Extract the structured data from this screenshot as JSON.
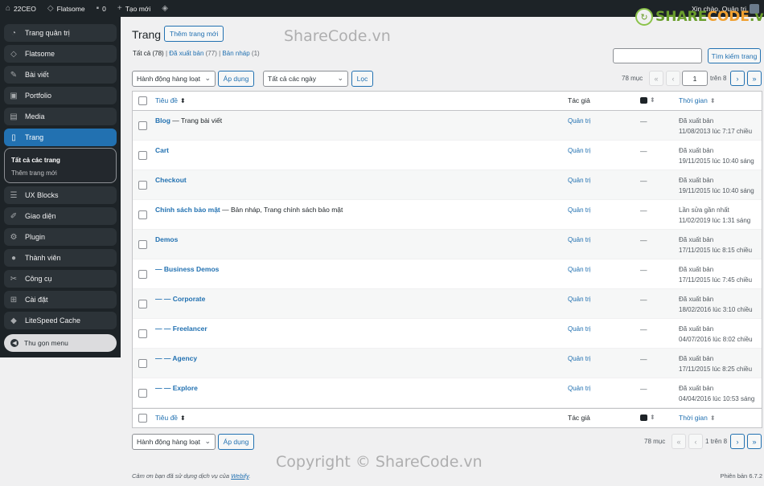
{
  "adminbar": {
    "site_name": "22CEO",
    "theme_name": "Flatsome",
    "comments_count": "0",
    "new_label": "Tạo mới",
    "greeting": "Xin chào, Quản trị"
  },
  "sidebar": {
    "items": [
      {
        "label": "Trang quản trị",
        "icon": "dashboard-icon"
      },
      {
        "label": "Flatsome",
        "icon": "flatsome-icon"
      },
      {
        "label": "Bài viết",
        "icon": "pin-icon"
      },
      {
        "label": "Portfolio",
        "icon": "portfolio-icon"
      },
      {
        "label": "Media",
        "icon": "media-icon"
      },
      {
        "label": "Trang",
        "icon": "page-icon"
      },
      {
        "label": "UX Blocks",
        "icon": "blocks-icon"
      },
      {
        "label": "Giao diện",
        "icon": "brush-icon"
      },
      {
        "label": "Plugin",
        "icon": "plugin-icon"
      },
      {
        "label": "Thành viên",
        "icon": "user-icon"
      },
      {
        "label": "Công cụ",
        "icon": "wrench-icon"
      },
      {
        "label": "Cài đặt",
        "icon": "settings-icon"
      },
      {
        "label": "LiteSpeed Cache",
        "icon": "litespeed-icon"
      }
    ],
    "submenu": [
      "Tất cả các trang",
      "Thêm trang mới"
    ],
    "collapse_label": "Thu gọn menu"
  },
  "page": {
    "title": "Trang",
    "add_new": "Thêm trang mới",
    "filters": {
      "all": "Tất cả",
      "all_count": "(78)",
      "published": "Đã xuất bản",
      "published_count": "(77)",
      "draft": "Bản nháp",
      "draft_count": "(1)"
    },
    "search_button": "Tìm kiếm trang",
    "bulk_action": "Hành động hàng loạt",
    "apply": "Áp dụng",
    "date_filter": "Tất cả các ngày",
    "filter_button": "Lọc",
    "items_count": "78 mục",
    "current_page": "1",
    "of_pages": "trên 8",
    "bottom_pages": "1 trên 8",
    "pager": {
      "first": "«",
      "prev": "‹",
      "next": "›",
      "last": "»"
    }
  },
  "table": {
    "headers": {
      "title": "Tiêu đề",
      "author": "Tác giả",
      "date": "Thời gian",
      "sort_both": "⬍"
    },
    "rows": [
      {
        "title": "Blog",
        "state": " — Trang bài viết",
        "author": "Quản trị",
        "comments": "—",
        "status": "Đã xuất bản",
        "datetime": "11/08/2013 lúc 7:17 chiều"
      },
      {
        "title": "Cart",
        "state": "",
        "author": "Quản trị",
        "comments": "—",
        "status": "Đã xuất bản",
        "datetime": "19/11/2015 lúc 10:40 sáng"
      },
      {
        "title": "Checkout",
        "state": "",
        "author": "Quản trị",
        "comments": "—",
        "status": "Đã xuất bản",
        "datetime": "19/11/2015 lúc 10:40 sáng"
      },
      {
        "title": "Chính sách bảo mật",
        "state": " — Bản nháp, Trang chính sách bảo mật",
        "author": "Quản trị",
        "comments": "—",
        "status": "Lần sửa gần nhất",
        "datetime": "11/02/2019 lúc 1:31 sáng"
      },
      {
        "title": "Demos",
        "state": "",
        "author": "Quản trị",
        "comments": "—",
        "status": "Đã xuất bản",
        "datetime": "17/11/2015 lúc 8:15 chiều"
      },
      {
        "title": "— Business Demos",
        "state": "",
        "author": "Quản trị",
        "comments": "—",
        "status": "Đã xuất bản",
        "datetime": "17/11/2015 lúc 7:45 chiều"
      },
      {
        "title": "— — Corporate",
        "state": "",
        "author": "Quản trị",
        "comments": "—",
        "status": "Đã xuất bản",
        "datetime": "18/02/2016 lúc 3:10 chiều"
      },
      {
        "title": "— — Freelancer",
        "state": "",
        "author": "Quản trị",
        "comments": "—",
        "status": "Đã xuất bản",
        "datetime": "04/07/2016 lúc 8:02 chiều"
      },
      {
        "title": "— — Agency",
        "state": "",
        "author": "Quản trị",
        "comments": "—",
        "status": "Đã xuất bản",
        "datetime": "17/11/2015 lúc 8:25 chiều"
      },
      {
        "title": "— — Explore",
        "state": "",
        "author": "Quản trị",
        "comments": "—",
        "status": "Đã xuất bản",
        "datetime": "04/04/2016 lúc 10:53 sáng"
      }
    ]
  },
  "footer": {
    "thanks_prefix": "Cảm ơn bạn đã sử dụng dịch vụ của ",
    "thanks_link": "Webify",
    "thanks_suffix": ".",
    "version": "Phiên bản 6.7.2"
  },
  "watermark": {
    "top": "ShareCode.vn",
    "bottom": "Copyright © ShareCode.vn",
    "logo_a": "SHARE",
    "logo_b": "CODE",
    "logo_c": ".vn"
  }
}
